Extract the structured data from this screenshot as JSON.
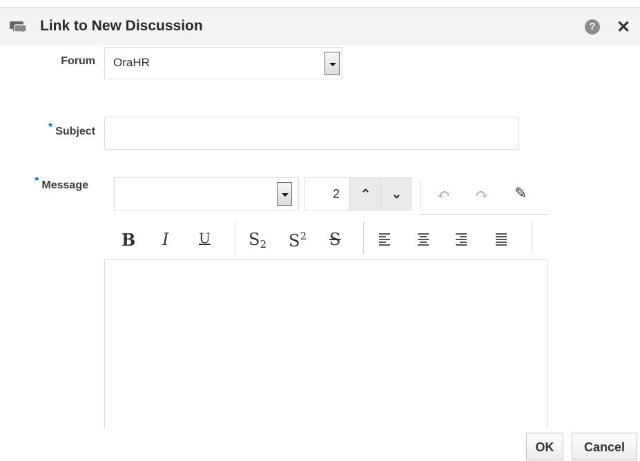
{
  "dialog": {
    "title": "Link to New Discussion",
    "help_icon": "?",
    "close_icon": "✕"
  },
  "form": {
    "forum_label": "Forum",
    "forum_value": "OraHR",
    "subject_label": "Subject",
    "subject_value": "",
    "message_label": "Message",
    "required_mark": "*"
  },
  "editor": {
    "font_value": "",
    "font_size": "2",
    "bold": "B",
    "italic": "I",
    "underline": "U",
    "subscript_base": "S",
    "subscript_mark": "2",
    "superscript_base": "S",
    "superscript_mark": "2",
    "strike": "S",
    "increase_glyph": "⌃",
    "decrease_glyph": "⌄",
    "undo_glyph": "↶",
    "redo_glyph": "↷",
    "clear_glyph": "✎",
    "body_text": ""
  },
  "actions": {
    "ok_label": "OK",
    "cancel_label": "Cancel"
  },
  "colors": {
    "required_mark": "#0572ce",
    "titlebar_bg": "#f4f4f4"
  }
}
